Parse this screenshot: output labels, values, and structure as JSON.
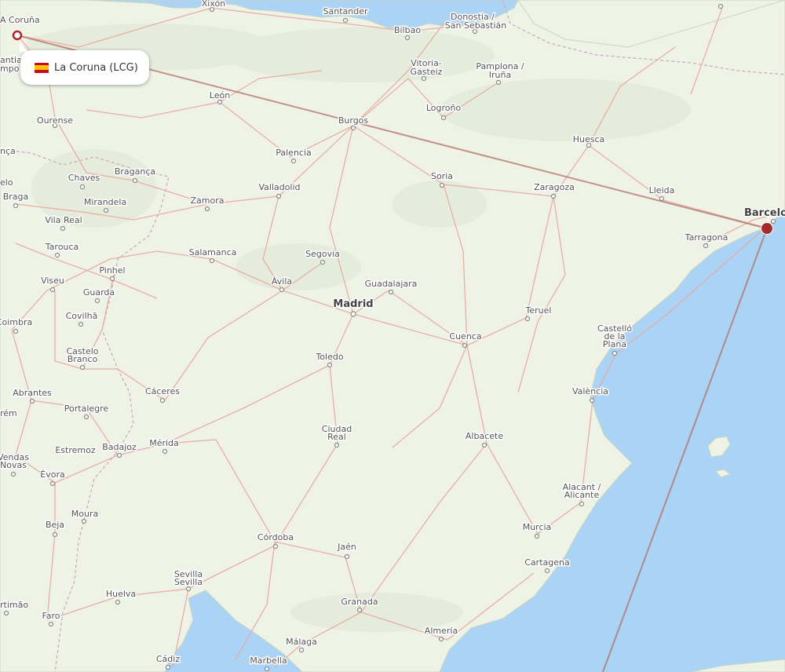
{
  "origin": {
    "name": "La Coruna",
    "code": "LCG",
    "label": "La Coruna (LCG)",
    "flag": "spain-flag"
  },
  "route_color": "#b3706a",
  "marker_color": "#a52a2a",
  "cities": [
    {
      "id": "la-coruna",
      "name": "A Coruña"
    },
    {
      "id": "xixon",
      "name": "Xixón"
    },
    {
      "id": "santander",
      "name": "Santander"
    },
    {
      "id": "bilbao",
      "name": "Bilbao"
    },
    {
      "id": "donostia",
      "name": "Donostia /"
    },
    {
      "id": "san-sebastian",
      "name": "San Sebastián"
    },
    {
      "id": "vitoria",
      "name": "Vitoria-"
    },
    {
      "id": "gasteiz",
      "name": "Gasteiz"
    },
    {
      "id": "pamplona",
      "name": "Pamplona /"
    },
    {
      "id": "iruna",
      "name": "Iruña"
    },
    {
      "id": "santiago",
      "name": "antiago"
    },
    {
      "id": "compostela",
      "name": "mpo"
    },
    {
      "id": "leon",
      "name": "León"
    },
    {
      "id": "logrono",
      "name": "Logroño"
    },
    {
      "id": "ourense",
      "name": "Ourense"
    },
    {
      "id": "burgos",
      "name": "Burgos"
    },
    {
      "id": "huesca",
      "name": "Huesca"
    },
    {
      "id": "palencia",
      "name": "Palencia"
    },
    {
      "id": "braganca",
      "name": "Bragança"
    },
    {
      "id": "chaves",
      "name": "Chaves"
    },
    {
      "id": "soria",
      "name": "Soria"
    },
    {
      "id": "zaragoza",
      "name": "Zaragoza"
    },
    {
      "id": "lleida",
      "name": "Lleida"
    },
    {
      "id": "valladolid",
      "name": "Valladolid"
    },
    {
      "id": "braga",
      "name": "Braga"
    },
    {
      "id": "zamora",
      "name": "Zamora"
    },
    {
      "id": "mirandela",
      "name": "Mirandela"
    },
    {
      "id": "barcelona",
      "name": "Barcelo"
    },
    {
      "id": "vila-real",
      "name": "Vila Real"
    },
    {
      "id": "tarragona",
      "name": "Tarragona"
    },
    {
      "id": "tarouca",
      "name": "Tarouca"
    },
    {
      "id": "salamanca",
      "name": "Salamanca"
    },
    {
      "id": "segovia",
      "name": "Segovia"
    },
    {
      "id": "pinhel",
      "name": "Pinhel"
    },
    {
      "id": "viseu",
      "name": "Viseu"
    },
    {
      "id": "avila",
      "name": "Ávila"
    },
    {
      "id": "guadalajara",
      "name": "Guadalajara"
    },
    {
      "id": "guarda",
      "name": "Guarda"
    },
    {
      "id": "madrid",
      "name": "Madrid"
    },
    {
      "id": "teruel",
      "name": "Teruel"
    },
    {
      "id": "coimbra",
      "name": "Coimbra"
    },
    {
      "id": "covilha",
      "name": "Covilhã"
    },
    {
      "id": "castello",
      "name": "Castelló"
    },
    {
      "id": "de-la",
      "name": "de la"
    },
    {
      "id": "plana",
      "name": "Plana"
    },
    {
      "id": "cuenca",
      "name": "Cuenca"
    },
    {
      "id": "castelo",
      "name": "Castelo"
    },
    {
      "id": "branco",
      "name": "Branco"
    },
    {
      "id": "toledo",
      "name": "Toledo"
    },
    {
      "id": "valencia",
      "name": "València"
    },
    {
      "id": "abrantes",
      "name": "Abrantes"
    },
    {
      "id": "caceres",
      "name": "Cáceres"
    },
    {
      "id": "portalegre",
      "name": "Portalegre"
    },
    {
      "id": "ciudad",
      "name": "Ciudad"
    },
    {
      "id": "real",
      "name": "Real"
    },
    {
      "id": "albacete",
      "name": "Albacete"
    },
    {
      "id": "merida",
      "name": "Mérida"
    },
    {
      "id": "estremoz",
      "name": "Estremoz"
    },
    {
      "id": "badajoz",
      "name": "Badajoz"
    },
    {
      "id": "vendas",
      "name": "Vendas"
    },
    {
      "id": "novas",
      "name": "Novas"
    },
    {
      "id": "evora",
      "name": "Évora"
    },
    {
      "id": "alacant",
      "name": "Alacant /"
    },
    {
      "id": "alicante",
      "name": "Alicante"
    },
    {
      "id": "moura",
      "name": "Moura"
    },
    {
      "id": "beja",
      "name": "Beja"
    },
    {
      "id": "murcia",
      "name": "Murcia"
    },
    {
      "id": "cordoba",
      "name": "Córdoba"
    },
    {
      "id": "jaen",
      "name": "Jaén"
    },
    {
      "id": "cartagena",
      "name": "Cartagena"
    },
    {
      "id": "sevilla",
      "name": "Sevilla"
    },
    {
      "id": "sevilla-2",
      "name": "Sevilla"
    },
    {
      "id": "huelva",
      "name": "Huelva"
    },
    {
      "id": "granada",
      "name": "Granada"
    },
    {
      "id": "portimao",
      "name": "rtimão"
    },
    {
      "id": "faro",
      "name": "Faro"
    },
    {
      "id": "almeria",
      "name": "Almería"
    },
    {
      "id": "malaga",
      "name": "Málaga"
    },
    {
      "id": "cadiz",
      "name": "Cádiz"
    },
    {
      "id": "marbella",
      "name": "Marbella"
    },
    {
      "id": "ceuc",
      "name": "rém"
    },
    {
      "id": "ganca",
      "name": "nça"
    },
    {
      "id": "pelo",
      "name": "elo"
    }
  ]
}
